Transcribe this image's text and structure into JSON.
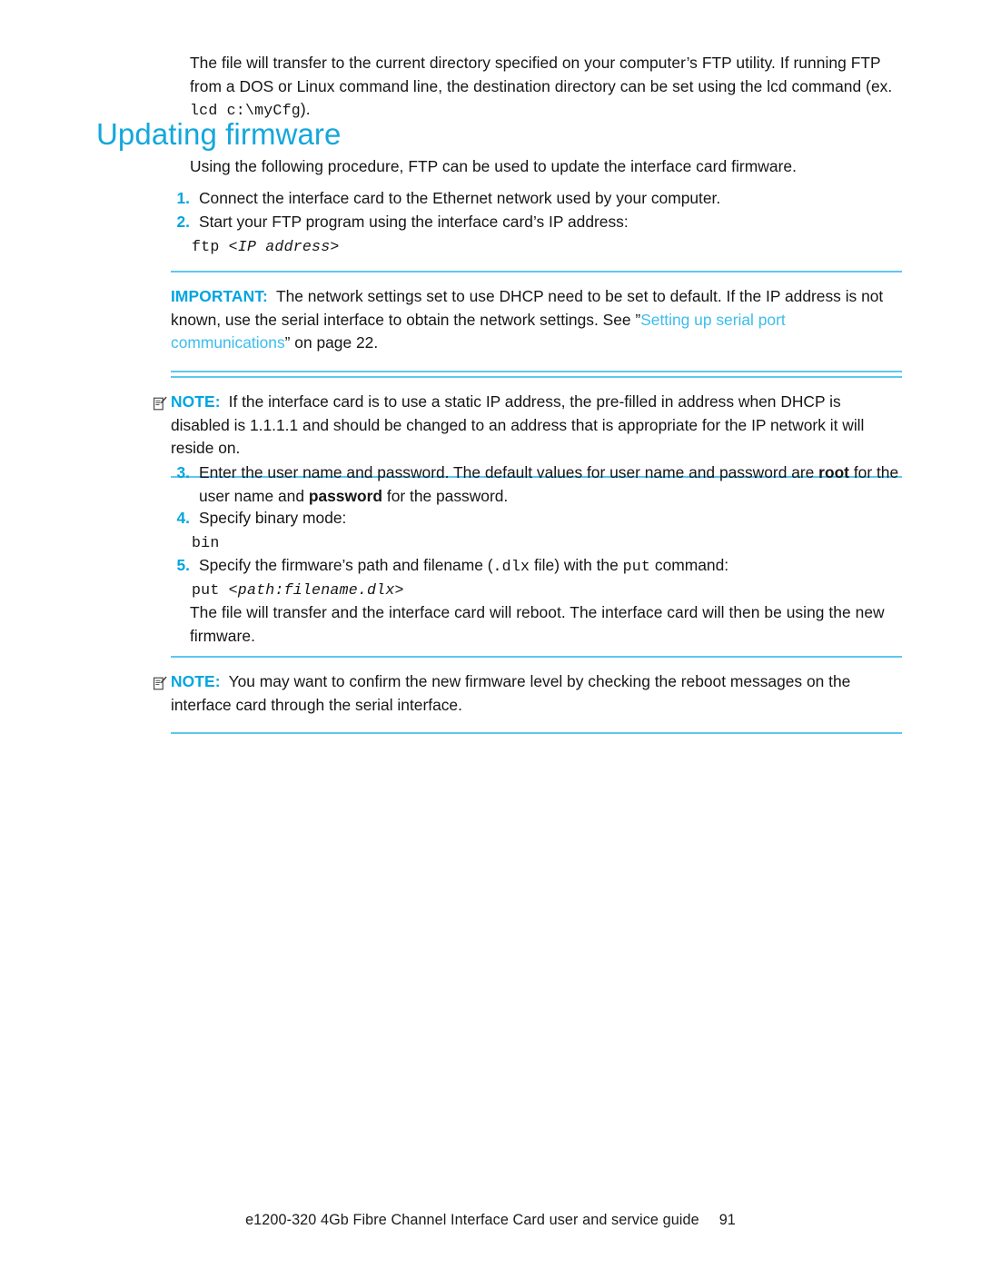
{
  "document": {
    "intro_paragraph": {
      "seg1": "The file will transfer to the current directory specified on your computer’s FTP utility. If running FTP from a DOS or Linux command line, the destination directory can be set using the lcd command (ex. ",
      "code1": "lcd c:\\myCfg",
      "seg2": ")."
    },
    "heading": "Updating firmware",
    "lead_paragraph": "Using the following procedure, FTP can be used to update the interface card firmware.",
    "steps": [
      {
        "number": "1.",
        "text": "Connect the interface card to the Ethernet network used by your computer."
      },
      {
        "number": "2.",
        "text": "Start your FTP program using the interface card’s IP address:"
      },
      {
        "number": "3.",
        "seg1": "Enter the user name and password. The default values for user name and password are ",
        "bold1": "root",
        "seg2": " for the user name and ",
        "bold2": "password",
        "seg3": " for the password."
      },
      {
        "number": "4.",
        "text": "Specify binary mode:"
      },
      {
        "number": "5.",
        "seg1": "Specify the firmware’s path and filename (",
        "code1": ".dlx",
        "seg2": " file) with the ",
        "code2": "put",
        "seg3": " command:"
      }
    ],
    "code_blocks": {
      "ftp_command_prefix": "ftp ",
      "ftp_command_arg": "<IP address>",
      "bin_command": "bin",
      "put_command_prefix": "put ",
      "put_command_arg": "<path:filename.dlx>"
    },
    "important_note": {
      "label": "IMPORTANT:",
      "seg1": "The network settings set to use DHCP need to be set to default. If the IP address is not known, use the serial interface to obtain the network settings. See ”",
      "link": "Setting up serial port communications",
      "seg2": "” on page 22."
    },
    "note_static_ip": {
      "icon": "note-pencil-icon",
      "label": "NOTE:",
      "text": "If the interface card is to use a static IP address, the pre-filled in address when DHCP is disabled is 1.1.1.1 and should be changed to an address that is appropriate for the IP network it will reside on."
    },
    "transfer_paragraph": "The file will transfer and the interface card will reboot. The interface card will then be using the new firmware.",
    "note_confirm_firmware": {
      "icon": "note-pencil-icon",
      "label": "NOTE:",
      "text": "You may want to confirm the new firmware level by checking the reboot messages on the interface card through the serial interface."
    },
    "footer": {
      "guide_title": "e1200-320 4Gb Fibre Channel Interface Card user and service guide",
      "page_number": "91"
    },
    "colors": {
      "heading_blue": "#14a7dd",
      "accent_blue": "#00a5e0",
      "link_blue": "#3bbdee",
      "rule_blue": "#5cc8f0",
      "body_text": "#161616"
    }
  }
}
